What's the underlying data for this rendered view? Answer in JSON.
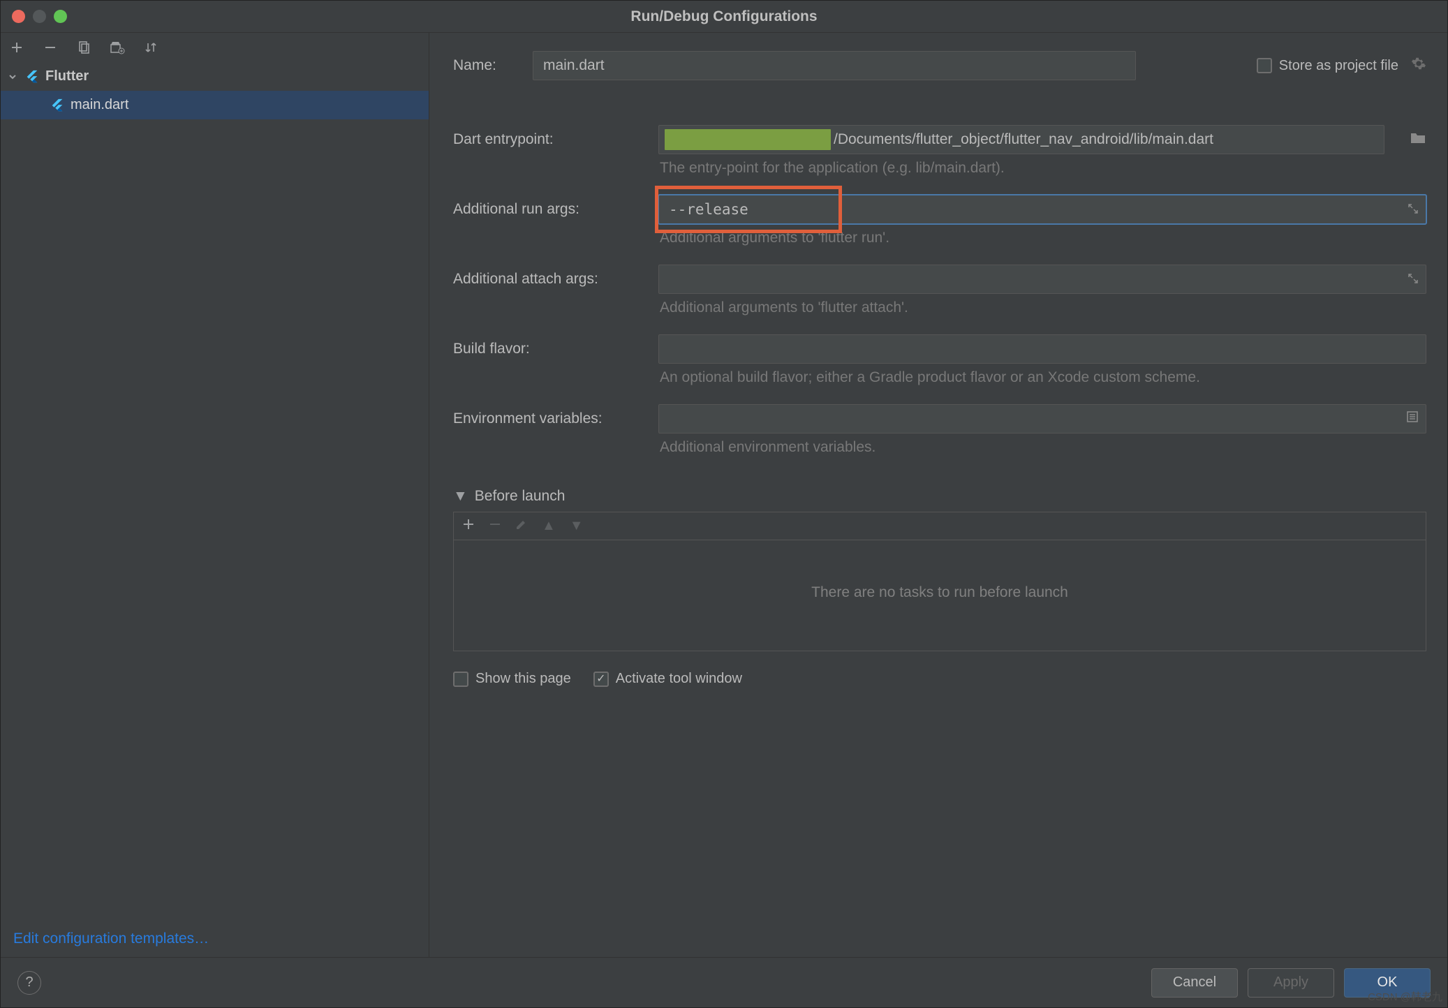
{
  "title": "Run/Debug Configurations",
  "sidebar": {
    "node_label": "Flutter",
    "leaf_label": "main.dart",
    "edit_templates": "Edit configuration templates…"
  },
  "form": {
    "name_label": "Name:",
    "name_value": "main.dart",
    "store_label": "Store as project file",
    "entry_label": "Dart entrypoint:",
    "entry_value": "/Documents/flutter_object/flutter_nav_android/lib/main.dart",
    "entry_hint": "The entry-point for the application (e.g. lib/main.dart).",
    "runargs_label": "Additional run args:",
    "runargs_value": "--release",
    "runargs_hint": "Additional arguments to 'flutter run'.",
    "attachargs_label": "Additional attach args:",
    "attachargs_value": "",
    "attachargs_hint": "Additional arguments to 'flutter attach'.",
    "flavor_label": "Build flavor:",
    "flavor_value": "",
    "flavor_hint": "An optional build flavor; either a Gradle product flavor or an Xcode custom scheme.",
    "env_label": "Environment variables:",
    "env_value": "",
    "env_hint": "Additional environment variables."
  },
  "before_launch": {
    "title": "Before launch",
    "empty": "There are no tasks to run before launch"
  },
  "checks": {
    "show_page": "Show this page",
    "activate_tool": "Activate tool window"
  },
  "buttons": {
    "cancel": "Cancel",
    "apply": "Apply",
    "ok": "OK"
  },
  "watermark": "CSDN @韩老九"
}
